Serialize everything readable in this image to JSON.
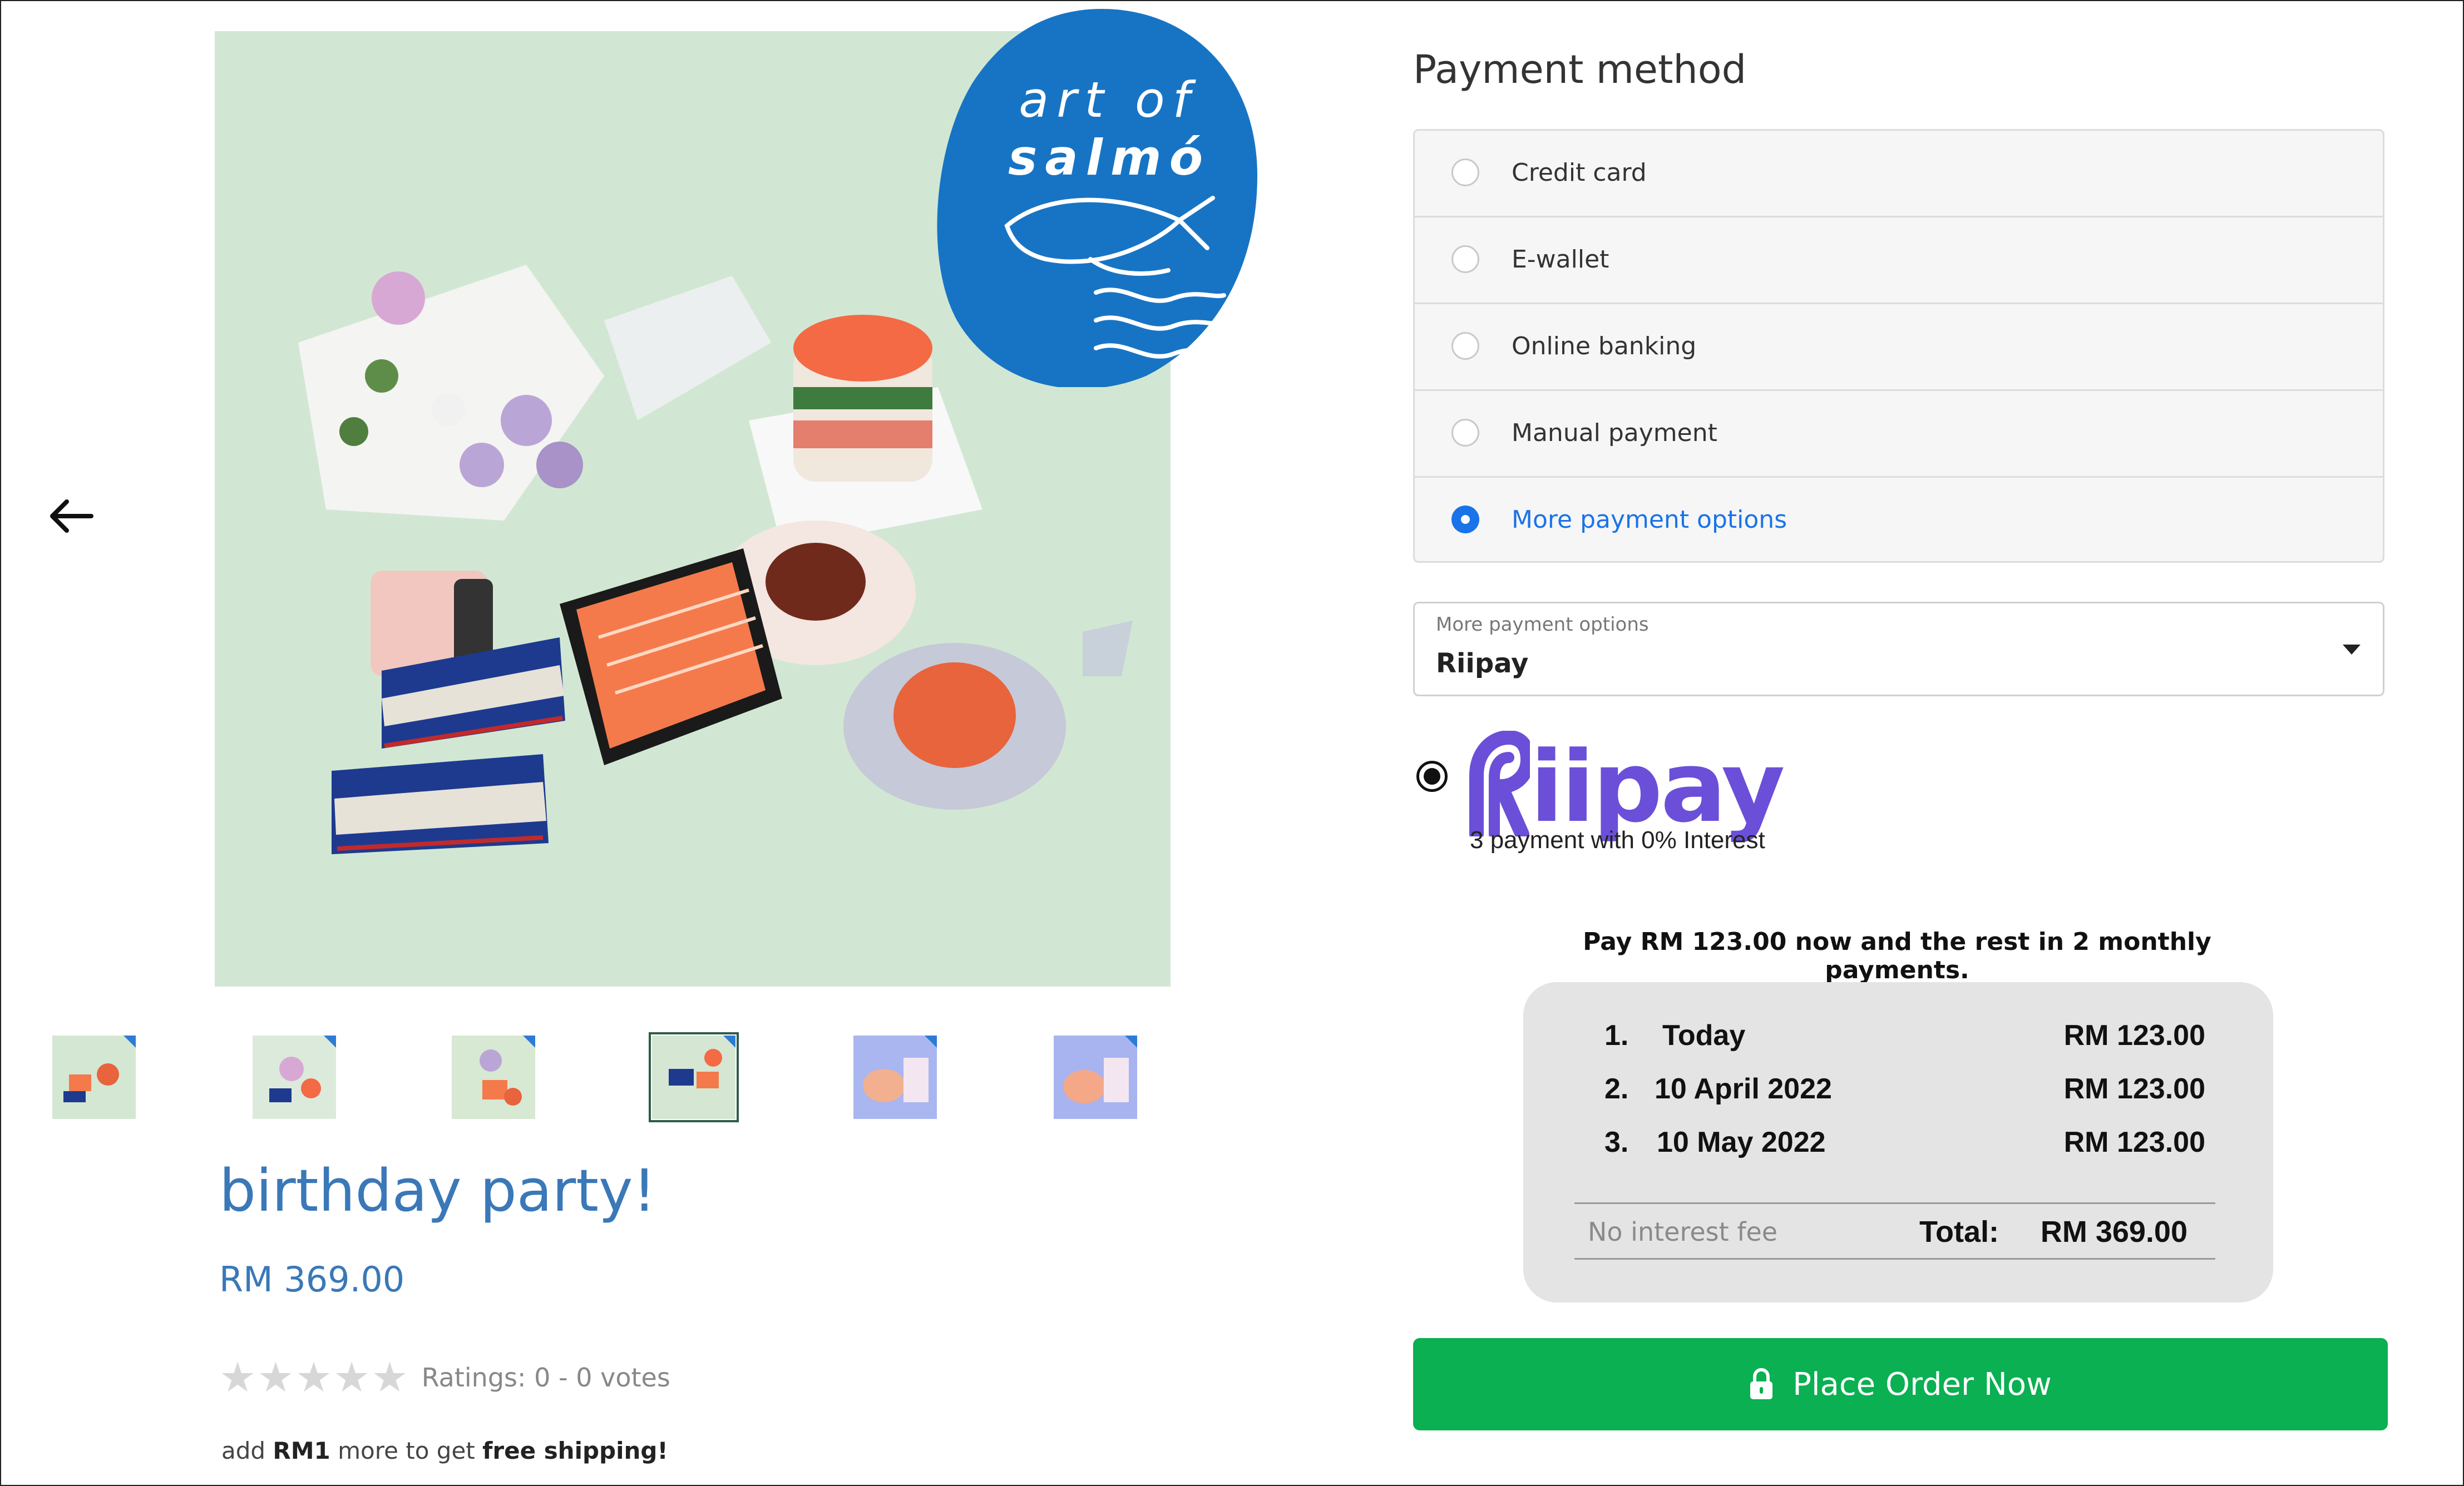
{
  "product": {
    "brand": {
      "line1": "art of",
      "line2": "salmó"
    },
    "title": "birthday party!",
    "price": "RM 369.00",
    "rating": {
      "stars_total": 5,
      "stars_filled": 0,
      "text": "Ratings: 0 - 0 votes"
    },
    "shipping": {
      "prefix": "add ",
      "amount": "RM1",
      "middle": " more to get ",
      "highlight": "free shipping!"
    },
    "thumbnails": [
      {
        "name": "thumbnail-1",
        "selected": false
      },
      {
        "name": "thumbnail-2",
        "selected": false
      },
      {
        "name": "thumbnail-3",
        "selected": false
      },
      {
        "name": "thumbnail-4",
        "selected": true
      },
      {
        "name": "thumbnail-5",
        "selected": false
      },
      {
        "name": "thumbnail-6",
        "selected": false
      }
    ],
    "icons": {
      "back": "arrow-left-icon",
      "star": "star-icon"
    }
  },
  "payment": {
    "title": "Payment method",
    "methods": [
      {
        "label": "Credit card",
        "selected": false
      },
      {
        "label": "E-wallet",
        "selected": false
      },
      {
        "label": "Online banking",
        "selected": false
      },
      {
        "label": "Manual payment",
        "selected": false
      },
      {
        "label": "More payment options",
        "selected": true
      }
    ],
    "more_options": {
      "label": "More payment options",
      "value": "Riipay"
    },
    "riipay": {
      "logo_text": "iipay",
      "tagline": "3 payment with 0% Interest"
    },
    "installments": {
      "headline": "Pay RM 123.00 now and the rest in 2 monthly payments.",
      "rows": [
        {
          "num": "1.",
          "date": "Today",
          "amount": "RM 123.00"
        },
        {
          "num": "2.",
          "date": "10 April 2022",
          "amount": "RM 123.00"
        },
        {
          "num": "3.",
          "date": "10 May 2022",
          "amount": "RM 123.00"
        }
      ],
      "no_fee": "No interest fee",
      "total_label": "Total:",
      "total_value": "RM 369.00"
    },
    "place_order": {
      "label": "Place Order Now",
      "icon": "lock-icon"
    }
  },
  "colors": {
    "accent_blue": "#1a73e8",
    "product_blue": "#3a78b8",
    "riipay_purple": "#6b4fd8",
    "order_green": "#0ab051",
    "brand_blob": "#1774c4"
  }
}
